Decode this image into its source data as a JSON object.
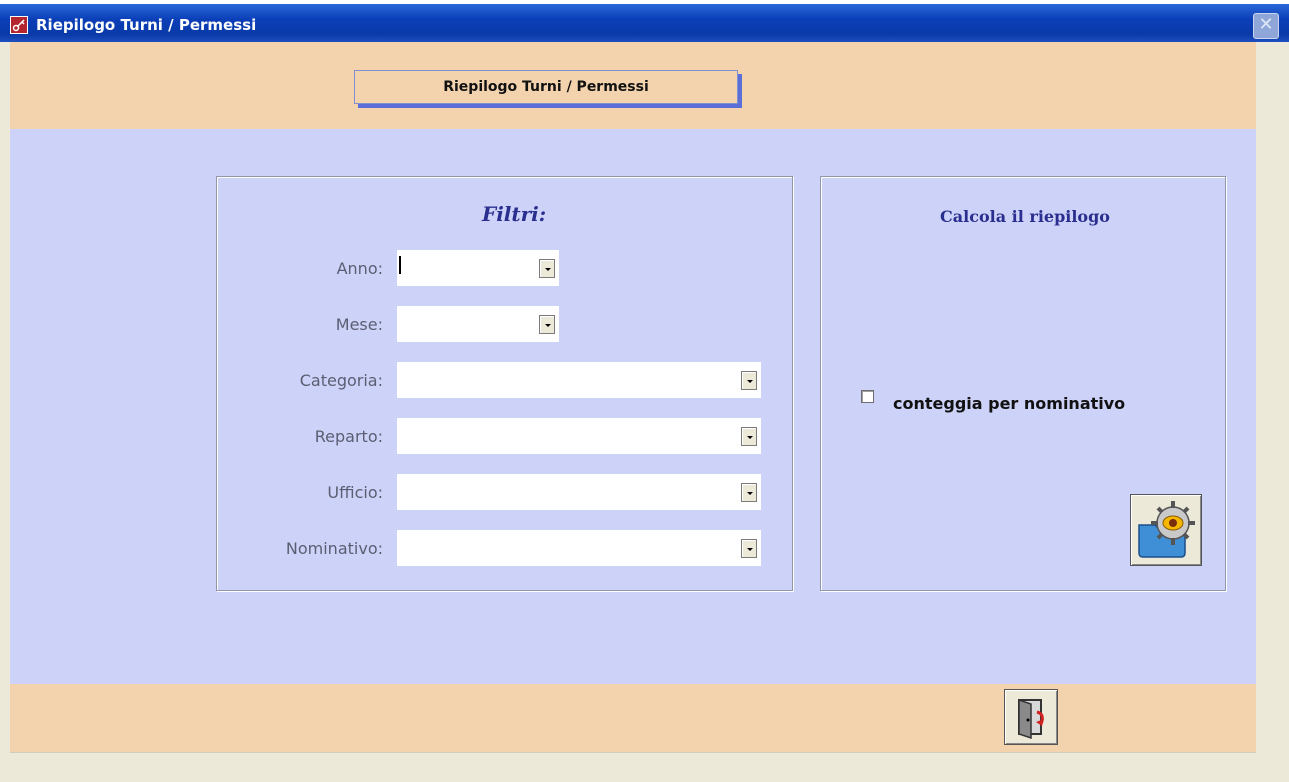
{
  "window": {
    "title": "Riepilogo Turni / Permessi",
    "close_label": "✕"
  },
  "header": {
    "label": "Riepilogo Turni / Permessi"
  },
  "filters": {
    "title": "Filtri:",
    "fields": [
      {
        "label": "Anno:",
        "value": ""
      },
      {
        "label": "Mese:",
        "value": ""
      },
      {
        "label": "Categoria:",
        "value": ""
      },
      {
        "label": "Reparto:",
        "value": ""
      },
      {
        "label": "Ufficio:",
        "value": ""
      },
      {
        "label": "Nominativo:",
        "value": ""
      }
    ]
  },
  "calc": {
    "title": "Calcola il riepilogo",
    "checkbox_label": "conteggia per nominativo",
    "checkbox_checked": false,
    "button_icon": "calculate-gear-icon"
  },
  "footer": {
    "exit_icon": "exit-door-icon"
  }
}
